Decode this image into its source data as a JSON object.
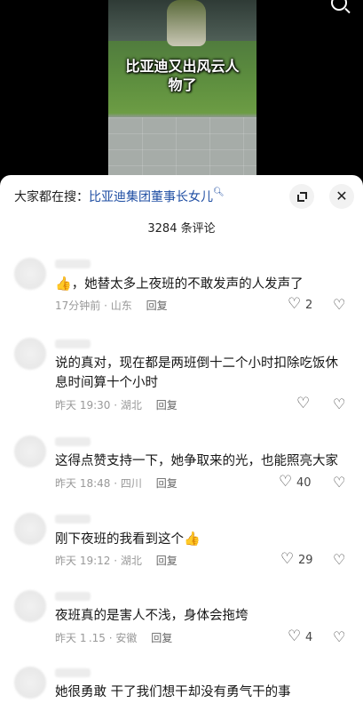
{
  "video": {
    "caption_line1": "比亚迪又出风云人",
    "caption_line2": "物了"
  },
  "search": {
    "prefix": "大家都在搜：",
    "query": "比亚迪集团董事长女儿",
    "icon": "magnifier-icon"
  },
  "comment_count": "3284 条评论",
  "comments": [
    {
      "emoji": "👍",
      "text": "，她替太多上夜班的不敢发声的人发声了",
      "time": "17分钟前",
      "location": "山东",
      "reply": "回复",
      "likes": "2"
    },
    {
      "text": "说的真对，现在都是两班倒十二个小时扣除吃饭休息时间算十个小时",
      "time": "昨天 19:30",
      "location": "湖北",
      "reply": "回复",
      "likes": ""
    },
    {
      "text": "这得点赞支持一下，她争取来的光，也能照亮大家",
      "time": "昨天 18:48",
      "location": "四川",
      "reply": "回复",
      "likes": "40"
    },
    {
      "text": "刚下夜班的我看到这个",
      "emoji": "👍",
      "time": "昨天 19:12",
      "location": "湖北",
      "reply": "回复",
      "likes": "29"
    },
    {
      "text": "夜班真的是害人不浅，身体会拖垮",
      "time": "昨天 1 .15",
      "location": "安徽",
      "reply": "回复",
      "likes": "4"
    },
    {
      "text": "她很勇敢 干了我们想干却没有勇气干的事",
      "time": "",
      "location": "",
      "reply": "",
      "likes": ""
    }
  ]
}
